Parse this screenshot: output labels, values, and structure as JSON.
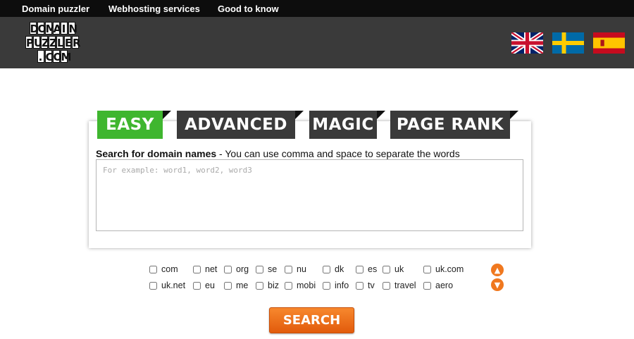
{
  "nav": {
    "items": [
      "Domain puzzler",
      "Webhosting services",
      "Good to know"
    ]
  },
  "logo": {
    "lines": [
      "DOMAIN",
      "PUZZLER",
      ".COM"
    ]
  },
  "flags": [
    "flag-uk-icon",
    "flag-sweden-icon",
    "flag-spain-icon"
  ],
  "tabs": [
    "EASY",
    "ADVANCED",
    "MAGIC",
    "PAGE RANK"
  ],
  "search": {
    "label_bold": "Search for domain names",
    "label_rest": " - You can use comma and space to separate the words",
    "placeholder": "For example: word1, word2, word3",
    "value": ""
  },
  "tlds": {
    "row1": [
      "com",
      "net",
      "org",
      "se",
      "nu",
      "dk",
      "es",
      "uk",
      "uk.com"
    ],
    "row2": [
      "uk.net",
      "eu",
      "me",
      "biz",
      "mobi",
      "info",
      "tv",
      "travel",
      "aero"
    ]
  },
  "search_button_label": "SEARCH",
  "colors": {
    "nav_bg": "#0d0d0d",
    "header_bg": "#3a3a3a",
    "active_tab": "#3fb62f",
    "inactive_tab": "#3a3a3a",
    "accent": "#f0781f"
  }
}
